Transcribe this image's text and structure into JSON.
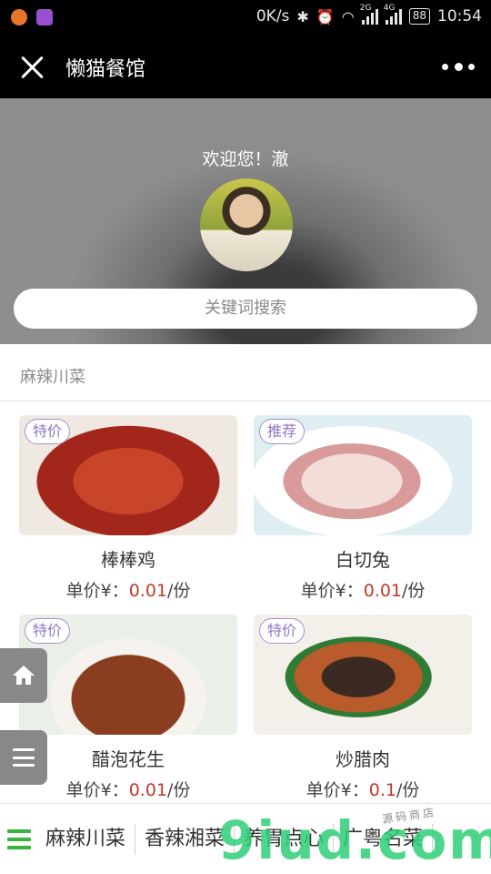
{
  "status_bar": {
    "speed": "0K/s",
    "net_2g": "2G",
    "net_4g": "4G",
    "battery": "88",
    "time": "10:54"
  },
  "header": {
    "title": "懒猫餐馆"
  },
  "hero": {
    "welcome": "欢迎您！澈",
    "search_placeholder": "关键词搜索"
  },
  "category": {
    "title": "麻辣川菜"
  },
  "products": [
    {
      "badge": "特价",
      "name": "棒棒鸡",
      "price_label": "单价¥：",
      "price": "0.01",
      "unit": "/份"
    },
    {
      "badge": "推荐",
      "name": "白切兔",
      "price_label": "单价¥：",
      "price": "0.01",
      "unit": "/份"
    },
    {
      "badge": "特价",
      "name": "醋泡花生",
      "price_label": "单价¥：",
      "price": "0.01",
      "unit": "/份"
    },
    {
      "badge": "特价",
      "name": "炒腊肉",
      "price_label": "单价¥：",
      "price": "0.1",
      "unit": "/份"
    }
  ],
  "bottom_nav": {
    "items": [
      "麻辣川菜",
      "香辣湘菜",
      "养胃点心",
      "广粤名菜"
    ],
    "watermark": "9iud.com",
    "watermark_sub": "源码商店"
  },
  "colors": {
    "accent_green": "#35b53a",
    "price_red": "#c0392b",
    "badge_purple": "#9077c4"
  }
}
